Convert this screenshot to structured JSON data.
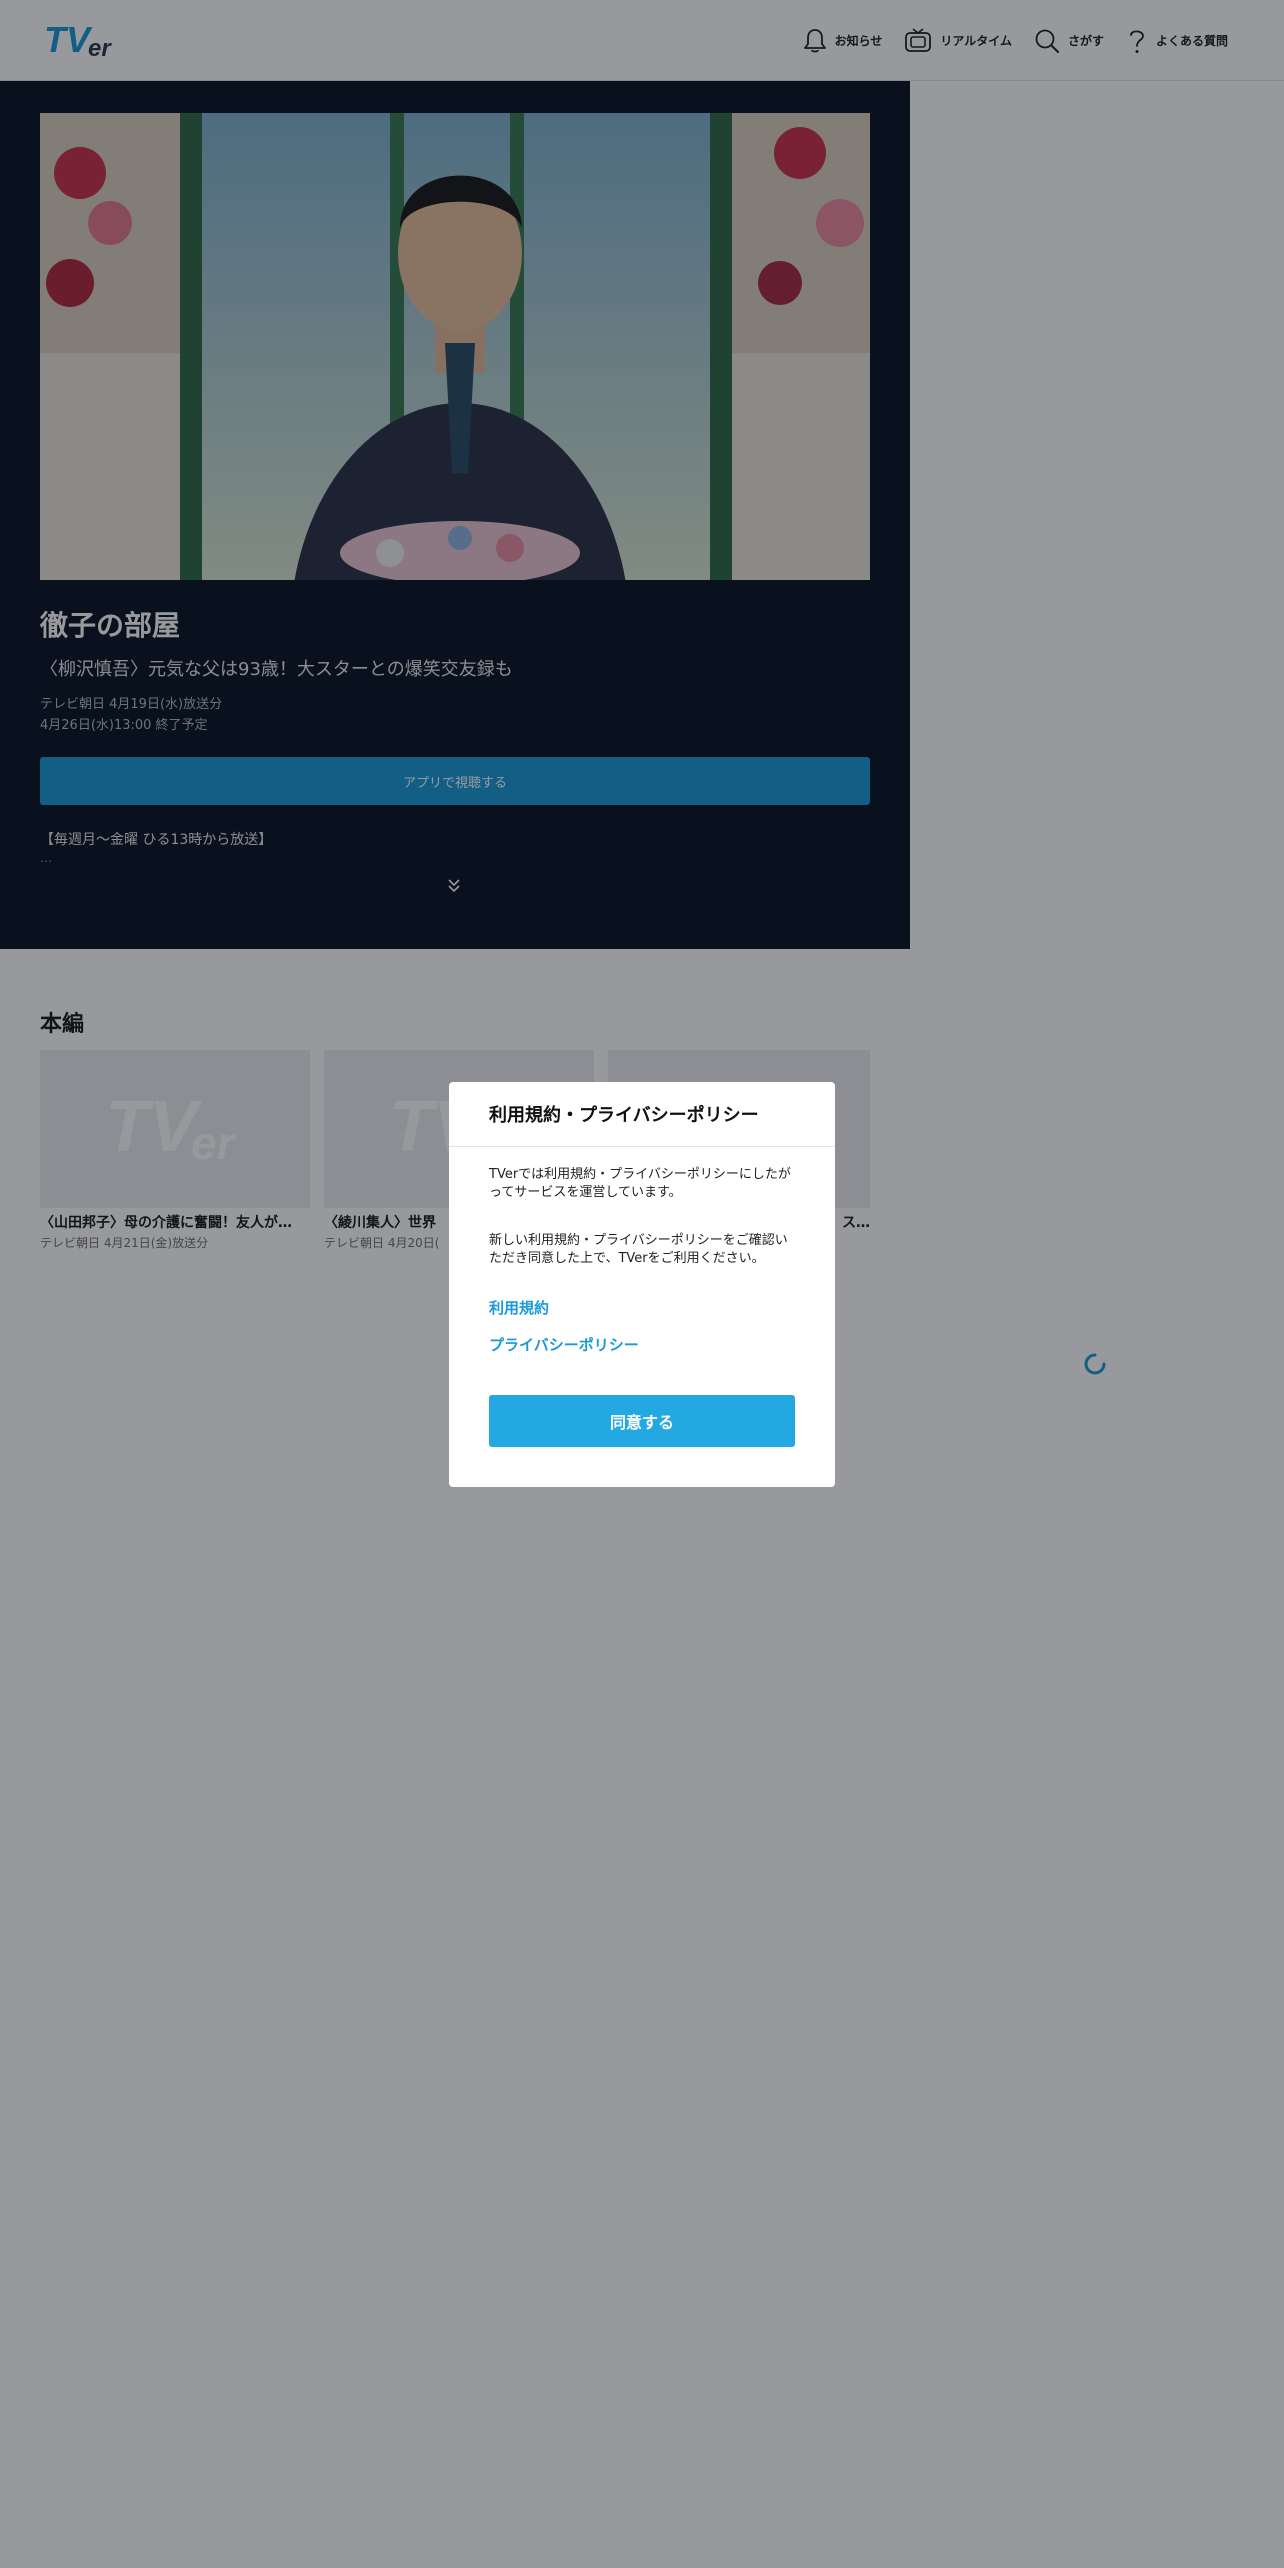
{
  "header": {
    "logo_text": "TVer",
    "nav": [
      {
        "label": "お知らせ",
        "icon": "bell-icon"
      },
      {
        "label": "リアルタイム",
        "icon": "tv-icon"
      },
      {
        "label": "さがす",
        "icon": "search-icon"
      },
      {
        "label": "よくある質問",
        "icon": "question-icon"
      }
    ]
  },
  "hero": {
    "title": "徹子の部屋",
    "subtitle": "〈柳沢慎吾〉元気な父は93歳！大スターとの爆笑交友録も",
    "broadcast": "テレビ朝日 4月19日(水)放送分",
    "expiry": "4月26日(水)13:00 終了予定",
    "watch_button": "アプリで視聴する",
    "description": "【毎週月～金曜 ひる13時から放送】",
    "ellipsis": "…"
  },
  "episodes": {
    "section_title": "本編",
    "items": [
      {
        "title": "〈山田邦子〉母の介護に奮闘！友人が…",
        "meta": "テレビ朝日 4月21日(金)放送分"
      },
      {
        "title": "〈綾川集人〉世界",
        "meta": "テレビ朝日 4月20日("
      },
      {
        "title": "ス…",
        "meta": ""
      }
    ]
  },
  "modal": {
    "title": "利用規約・プライバシーポリシー",
    "text1": "TVerでは利用規約・プライバシーポリシーにしたがってサービスを運営しています。",
    "text2": "新しい利用規約・プライバシーポリシーをご確認いただき同意した上で、TVerをご利用ください。",
    "link_terms": "利用規約",
    "link_privacy": "プライバシーポリシー",
    "agree_button": "同意する"
  },
  "colors": {
    "brand_blue": "#1a9ad7",
    "hero_bg": "#0b1526",
    "agree_bg": "#23a8e2"
  }
}
